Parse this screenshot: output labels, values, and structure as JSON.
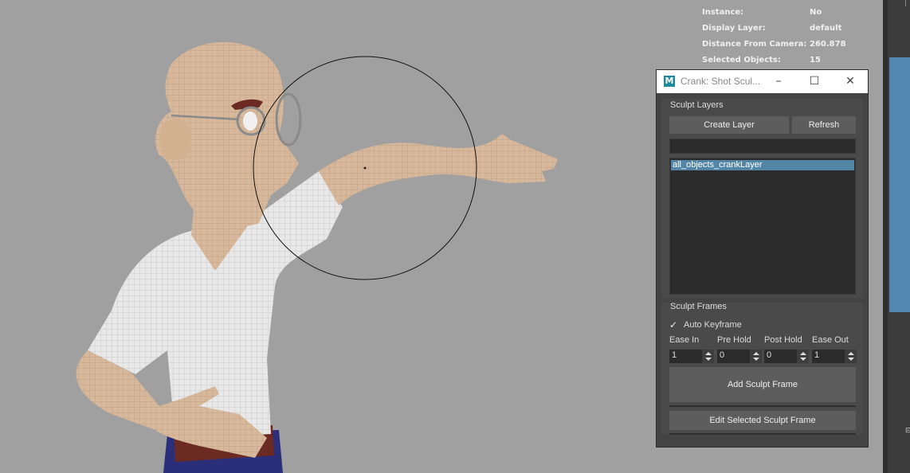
{
  "hud": {
    "rows": [
      {
        "label": "Instance:",
        "value": "No"
      },
      {
        "label": "Display Layer:",
        "value": "default"
      },
      {
        "label": "Distance From Camera:",
        "value": "260.878"
      },
      {
        "label": "Selected Objects:",
        "value": "15"
      }
    ]
  },
  "dialog": {
    "icon": "M",
    "title": "Crank: Shot Scul...",
    "minimize_icon": "–",
    "maximize_icon": "☐",
    "close_icon": "✕",
    "layers_section": {
      "title": "Sculpt Layers",
      "create_button": "Create Layer",
      "refresh_button": "Refresh",
      "name_field": "",
      "items": [
        "all_objects_crankLayer"
      ]
    },
    "frames_section": {
      "title": "Sculpt Frames",
      "auto_keyframe_label": "Auto Keyframe",
      "auto_keyframe_checked": true,
      "check_mark": "✓",
      "ease_in_label": "Ease In",
      "pre_hold_label": "Pre Hold",
      "post_hold_label": "Post Hold",
      "ease_out_label": "Ease Out",
      "ease_in": "1",
      "pre_hold": "0",
      "post_hold": "0",
      "ease_out": "1",
      "add_button": "Add Sculpt Frame",
      "edit_button": "Edit Selected Sculpt Frame"
    }
  },
  "colors": {
    "viewport": "#a0a0a0",
    "panel": "#444444",
    "selection": "#5285a6",
    "accent_strip": "#5287b0"
  }
}
